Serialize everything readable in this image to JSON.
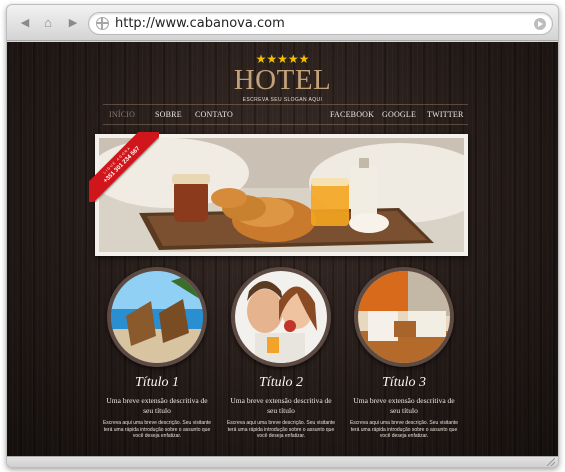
{
  "browser": {
    "url": "http://www.cabanova.com"
  },
  "header": {
    "stars": "★★★★★",
    "logo": "HOTEL",
    "slogan": "ESCREVA SEU SLOGAN AQUI"
  },
  "menu": {
    "left": [
      "INÍCIO",
      "SOBRE",
      "CONTATO"
    ],
    "right": [
      "FACEBOOK",
      "GOOGLE",
      "TWITTER"
    ]
  },
  "ribbon": {
    "small": "LIGUE AGORA",
    "phone": "+351 301 234 567"
  },
  "features": [
    {
      "title": "Título 1",
      "subtitle": "Uma breve extensão descritiva de seu título",
      "body": "Escreva aqui uma breve descrição. Seu visitante terá uma rápida introdução sobre o assunto que você deseja enfatizar."
    },
    {
      "title": "Título 2",
      "subtitle": "Uma breve extensão descritiva de seu título",
      "body": "Escreva aqui uma breve descrição. Seu visitante terá uma rápida introdução sobre o assunto que você deseja enfatizar."
    },
    {
      "title": "Título 3",
      "subtitle": "Uma breve extensão descritiva de seu título",
      "body": "Escreva aqui uma breve descrição. Seu visitante terá uma rápida introdução sobre o assunto que você deseja enfatizar."
    }
  ],
  "colors": {
    "background": "#241b18",
    "logo": "#c3a27a",
    "stars": "#f2c200",
    "ribbon": "#d0161b"
  }
}
